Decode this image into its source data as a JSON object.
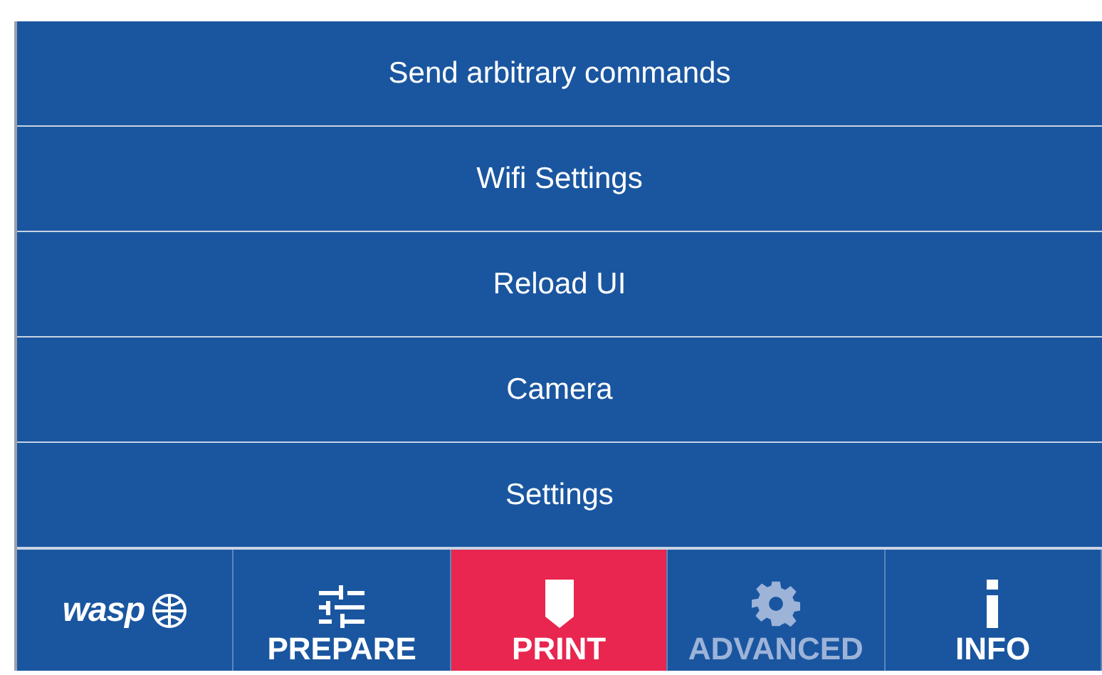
{
  "menu_items": [
    {
      "label": "Send arbitrary commands"
    },
    {
      "label": "Wifi Settings"
    },
    {
      "label": "Reload UI"
    },
    {
      "label": "Camera"
    },
    {
      "label": "Settings"
    }
  ],
  "logo": {
    "text": "wasp"
  },
  "tabs": [
    {
      "label": "PREPARE",
      "kind": "sliders",
      "selected": false,
      "disabled": false
    },
    {
      "label": "PRINT",
      "kind": "print",
      "selected": true,
      "disabled": false
    },
    {
      "label": "ADVANCED",
      "kind": "gear",
      "selected": false,
      "disabled": true
    },
    {
      "label": "INFO",
      "kind": "info",
      "selected": false,
      "disabled": false
    }
  ]
}
